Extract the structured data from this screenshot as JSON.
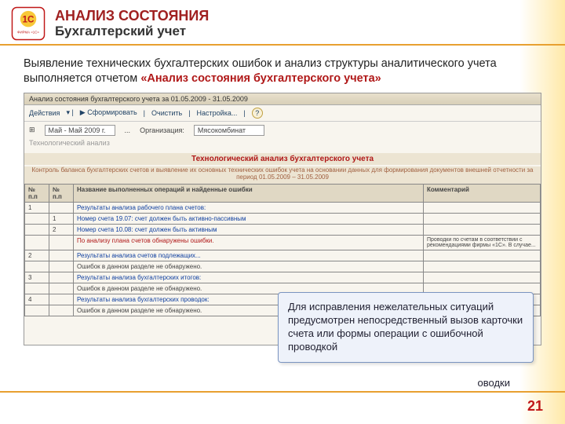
{
  "header": {
    "title_red": "АНАЛИЗ СОСТОЯНИЯ",
    "title_black": "Бухгалтерский учет",
    "logo_alt": "1C ФИРМА «1С»"
  },
  "intro": {
    "text_before": "Выявление технических бухгалтерских ошибок и анализ структуры аналитического учета выполняется отчетом ",
    "highlight": "«Анализ состояния бухгалтерского учета»"
  },
  "window": {
    "title": "Анализ состояния бухгалтерского учета за 01.05.2009 - 31.05.2009",
    "toolbar": {
      "actions": "Действия",
      "form": "Сформировать",
      "clear": "Очистить",
      "settings": "Настройка..."
    },
    "filter": {
      "period_label": "",
      "period_value": "Май - Май 2009 г.",
      "org_label": "Организация:",
      "org_value": "Мясокомбинат"
    },
    "tech_label": "Технологический анализ"
  },
  "report": {
    "title": "Технологический анализ бухгалтерского учета",
    "subtitle": "Контроль баланса бухгалтерских счетов и выявление их основных технических ошибок учета на основании данных для формирования документов внешней отчетности за период 01.05.2009 – 31.05.2009",
    "cols": {
      "num1": "№ п.п",
      "num2": "№ п.п",
      "name": "Название выполненных операций и найденные ошибки",
      "comment": "Комментарий"
    },
    "rows": [
      {
        "n": "1",
        "text": "Результаты анализа рабочего плана счетов:"
      },
      {
        "n": "",
        "sub": "1",
        "text": "Номер счета 19.07: счет должен быть активно-пассивным"
      },
      {
        "n": "",
        "sub": "2",
        "text": "Номер счета 10.08: счет должен быть активным"
      },
      {
        "n": "",
        "text": "По анализу плана счетов обнаружены ошибки.",
        "comment": "Проводки по счетам в соответствии с рекомендациями фирмы «1С». В случае..."
      },
      {
        "n": "2",
        "text": "Результаты анализа счетов подлежащих..."
      },
      {
        "n": "",
        "text": "Ошибок в данном разделе не обнаружено."
      },
      {
        "n": "3",
        "text": "Результаты анализа бухгалтерских итогов:"
      },
      {
        "n": "",
        "text": "Ошибок в данном разделе не обнаружено."
      },
      {
        "n": "4",
        "text": "Результаты анализа бухгалтерских проводок:"
      },
      {
        "n": "",
        "text": "Ошибок в данном разделе не обнаружено."
      }
    ]
  },
  "callout": {
    "text": "Для исправления нежелательных ситуаций предусмотрен непосредственный вызов карточки счета или формы операции с ошибочной проводкой",
    "tail": "оводки"
  },
  "page": "21"
}
